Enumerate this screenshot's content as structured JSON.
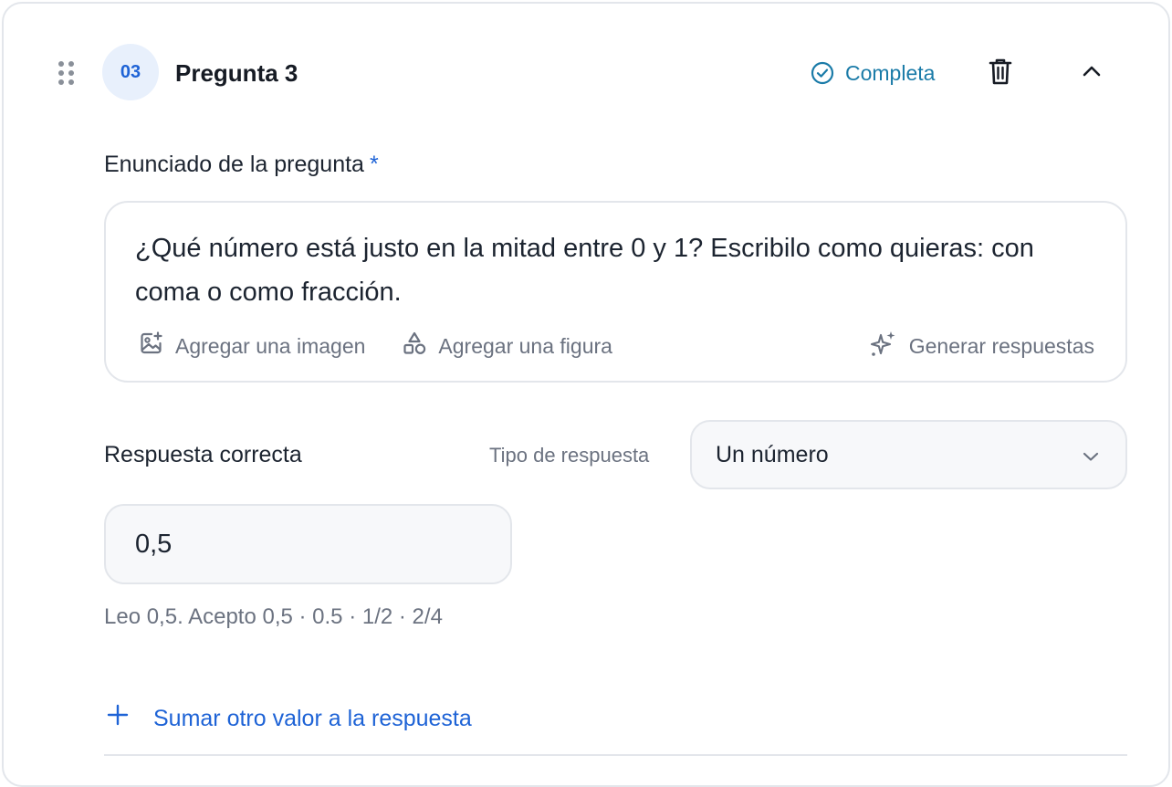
{
  "question": {
    "number": "03",
    "title": "Pregunta 3",
    "status": "Completa"
  },
  "statement": {
    "label": "Enunciado de la pregunta",
    "required_marker": "*",
    "text": "¿Qué número está justo en la mitad entre 0 y 1? Escribilo como quieras: con coma o como fracción.",
    "actions": {
      "add_image": "Agregar una imagen",
      "add_figure": "Agregar una figura",
      "generate_answers": "Generar respuestas"
    }
  },
  "answer": {
    "label": "Respuesta correcta",
    "type_label": "Tipo de respuesta",
    "type_value": "Un número",
    "value": "0,5",
    "hint": "Leo 0,5. Acepto 0,5 · 0.5 · 1/2 · 2/4",
    "add_value": "Sumar otro valor a la respuesta"
  },
  "colors": {
    "accent": "#1e63d6",
    "status": "#1a7ba8",
    "muted_text": "#6b7280",
    "border": "#e3e6eb"
  },
  "icons": {
    "drag": "drag-handle-icon",
    "status": "check-circle-icon",
    "delete": "trash-icon",
    "collapse": "chevron-up-icon",
    "image": "image-plus-icon",
    "figure": "shapes-icon",
    "generate": "sparkles-icon",
    "select": "chevron-down-icon",
    "add": "plus-icon"
  }
}
